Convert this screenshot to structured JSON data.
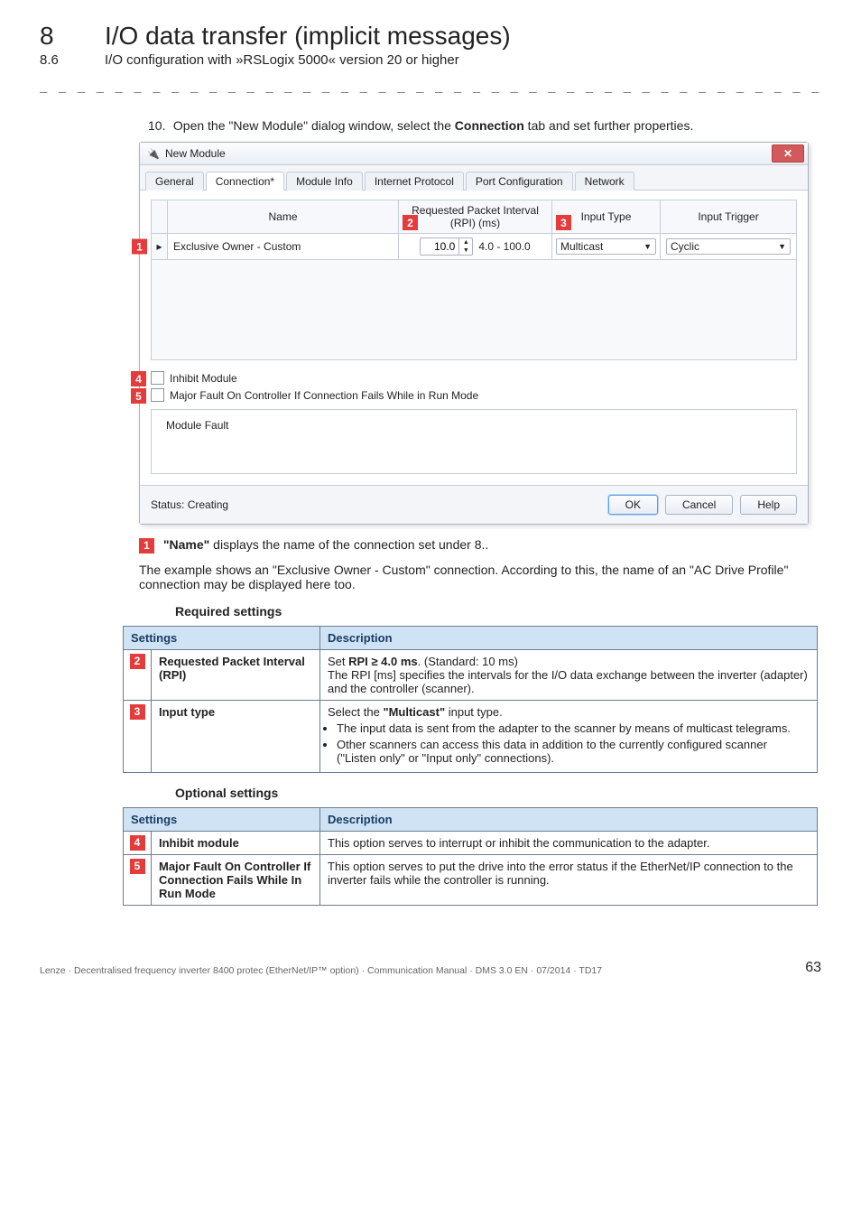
{
  "header": {
    "secnum": "8",
    "sectitle": "I/O data transfer (implicit messages)",
    "subnum": "8.6",
    "subtitle": "I/O configuration with »RSLogix 5000« version 20 or higher"
  },
  "dashes": "_ _ _ _ _ _ _ _ _ _ _ _ _ _ _ _ _ _ _ _ _ _ _ _ _ _ _ _ _ _ _ _ _ _ _ _ _ _ _ _ _ _ _ _ _ _ _ _ _ _ _ _ _ _ _ _ _ _ _ _ _ _ _ _",
  "step": {
    "num": "10.",
    "text_a": "Open the \"New Module\" dialog window, select the ",
    "text_strong": "Connection",
    "text_b": " tab and set further properties."
  },
  "dialog": {
    "title": "New Module",
    "tabs": [
      "General",
      "Connection*",
      "Module Info",
      "Internet Protocol",
      "Port Configuration",
      "Network"
    ],
    "cols": {
      "name": "Name",
      "rpi": "Requested Packet Interval (RPI) (ms)",
      "type": "Input Type",
      "trig": "Input Trigger"
    },
    "row": {
      "name": "Exclusive Owner - Custom",
      "rpi_value": "10.0",
      "rpi_range": "4.0 - 100.0",
      "type": "Multicast",
      "trig": "Cyclic"
    },
    "check1": "Inhibit Module",
    "check2": "Major Fault On Controller If Connection Fails While in Run Mode",
    "fieldset": "Module Fault",
    "status": "Status: Creating",
    "ok": "OK",
    "cancel": "Cancel",
    "help": "Help",
    "callouts": {
      "c1": "1",
      "c2": "2",
      "c3": "3",
      "c4": "4",
      "c5": "5"
    }
  },
  "explain": {
    "name_line_b": " displays the name of the connection set under 8..",
    "name_line_strong": "\"Name\"",
    "para": "The example shows an \"Exclusive Owner - Custom\" connection. According to this, the name of an \"AC Drive Profile\" connection may be displayed here too."
  },
  "req": {
    "heading": "Required settings",
    "th1": "Settings",
    "th2": "Description",
    "rows": [
      {
        "num": "2",
        "setting": "Requested Packet Interval (RPI)",
        "desc_lines": [
          {
            "pre": "Set ",
            "strong": "RPI ≥ 4.0 ms",
            "post": ". (Standard: 10 ms)"
          },
          {
            "plain": "The RPI [ms] specifies the intervals for the I/O data exchange between the inverter (adapter) and the controller (scanner)."
          }
        ]
      },
      {
        "num": "3",
        "setting": "Input type",
        "is_bulleted": true,
        "lead": {
          "pre": "Select the ",
          "strong": "\"Multicast\"",
          "post": " input type."
        },
        "bullets": [
          "The input data is sent from the adapter to the scanner by means of multicast telegrams.",
          "Other scanners can access this data in addition to the currently configured scanner (\"Listen only\" or \"Input only\" connections)."
        ]
      }
    ]
  },
  "opt": {
    "heading": "Optional settings",
    "th1": "Settings",
    "th2": "Description",
    "rows": [
      {
        "num": "4",
        "setting": "Inhibit module",
        "desc": "This option serves to interrupt or inhibit the communication to the adapter."
      },
      {
        "num": "5",
        "setting": "Major Fault On Controller If Connection Fails While In Run Mode",
        "desc": "This option serves to put the drive into the error status if the EtherNet/IP connection to the inverter fails while the controller is running."
      }
    ]
  },
  "footer": {
    "left": "Lenze · Decentralised frequency inverter 8400 protec (EtherNet/IP™ option) · Communication Manual · DMS 3.0 EN · 07/2014 · TD17",
    "right": "63"
  }
}
